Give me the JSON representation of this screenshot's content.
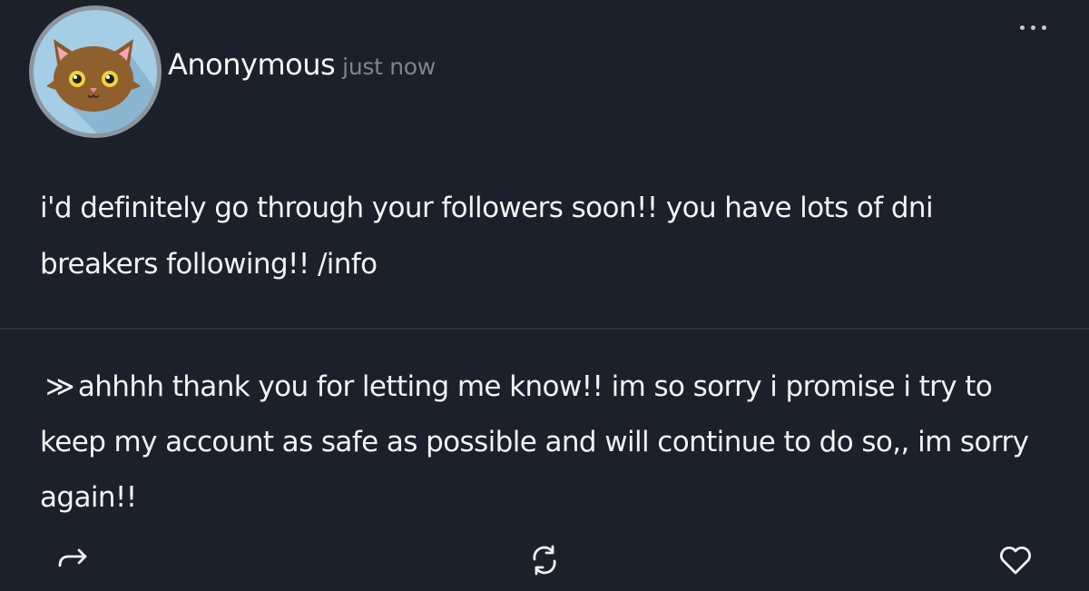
{
  "post": {
    "author": "Anonymous",
    "timestamp": "just now",
    "question": "i'd definitely go through your followers soon!! you have lots of dni breakers following!! /info",
    "answer_marker": "≫",
    "answer": "ahhhh thank you for letting me know!! im so sorry i promise i try to keep my account as safe as possible and will continue to do so,, im sorry again!!"
  },
  "avatar": {
    "icon": "cat-face-avatar",
    "background_color": "#a5cde6",
    "ring_color": "#8d969f"
  },
  "icons": {
    "menu": "more-options-icon",
    "share": "share-arrow-icon",
    "reblog": "reblog-icon",
    "like": "heart-icon"
  },
  "colors": {
    "background": "#1b202b",
    "text": "#f2f2f2",
    "muted": "#7d8591",
    "divider": "#2c3340"
  }
}
